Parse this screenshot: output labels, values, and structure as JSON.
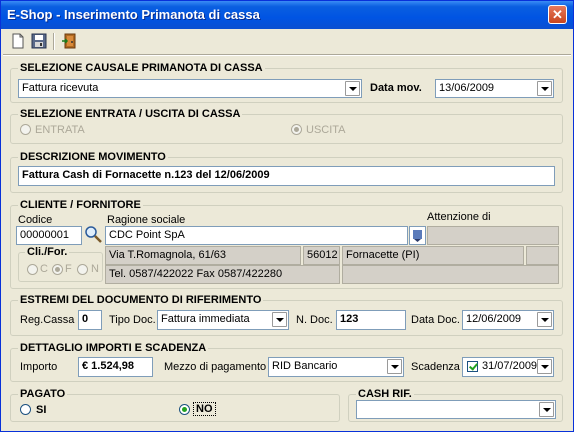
{
  "window": {
    "title": "E-Shop - Inserimento Primanota di cassa",
    "close": "✕"
  },
  "toolbar": {
    "new": "new-document-icon",
    "save": "save-icon",
    "exit": "exit-door-icon"
  },
  "causale": {
    "title": "SELEZIONE CAUSALE PRIMANOTA DI CASSA",
    "value": "Fattura ricevuta",
    "data_mov_label": "Data mov.",
    "data_mov_value": "13/06/2009"
  },
  "entrata_uscita": {
    "title": "SELEZIONE  ENTRATA / USCITA DI CASSA",
    "entrata_label": "ENTRATA",
    "uscita_label": "USCITA",
    "selected": "uscita"
  },
  "descrizione": {
    "title": "DESCRIZIONE MOVIMENTO",
    "value": "Fattura Cash di Fornacette n.123 del 12/06/2009"
  },
  "cliente": {
    "title": "CLIENTE / FORNITORE",
    "codice_label": "Codice",
    "codice_value": "00000001",
    "ragione_label": "Ragione sociale",
    "ragione_value": "CDC Point SpA",
    "attenzione_label": "Attenzione di",
    "attenzione_value": "",
    "clifor_label": "Cli./For.",
    "clifor_c": "C",
    "clifor_f": "F",
    "clifor_n": "N",
    "indirizzo": "Via T.Romagnola, 61/63",
    "cap": "56012",
    "citta": "Fornacette (PI)",
    "extra": "",
    "telefono": "Tel. 0587/422022 Fax 0587/422280",
    "extra2": ""
  },
  "documento": {
    "title": "ESTREMI DEL DOCUMENTO DI RIFERIMENTO",
    "reg_cassa_label": "Reg.Cassa",
    "reg_cassa_value": "0",
    "tipo_doc_label": "Tipo Doc.",
    "tipo_doc_value": "Fattura immediata",
    "n_doc_label": "N. Doc.",
    "n_doc_value": "123",
    "data_doc_label": "Data Doc.",
    "data_doc_value": "12/06/2009"
  },
  "importi": {
    "title": "DETTAGLIO IMPORTI E SCADENZA",
    "importo_label": "Importo",
    "importo_value": "€ 1.524,98",
    "mezzo_label": "Mezzo di pagamento",
    "mezzo_value": "RID Bancario",
    "scadenza_label": "Scadenza",
    "scadenza_value": "31/07/2009"
  },
  "pagato": {
    "title": "PAGATO",
    "si_label": "SI",
    "no_label": "NO",
    "selected": "no"
  },
  "cash_rif": {
    "title": "CASH RIF.",
    "value": ""
  }
}
